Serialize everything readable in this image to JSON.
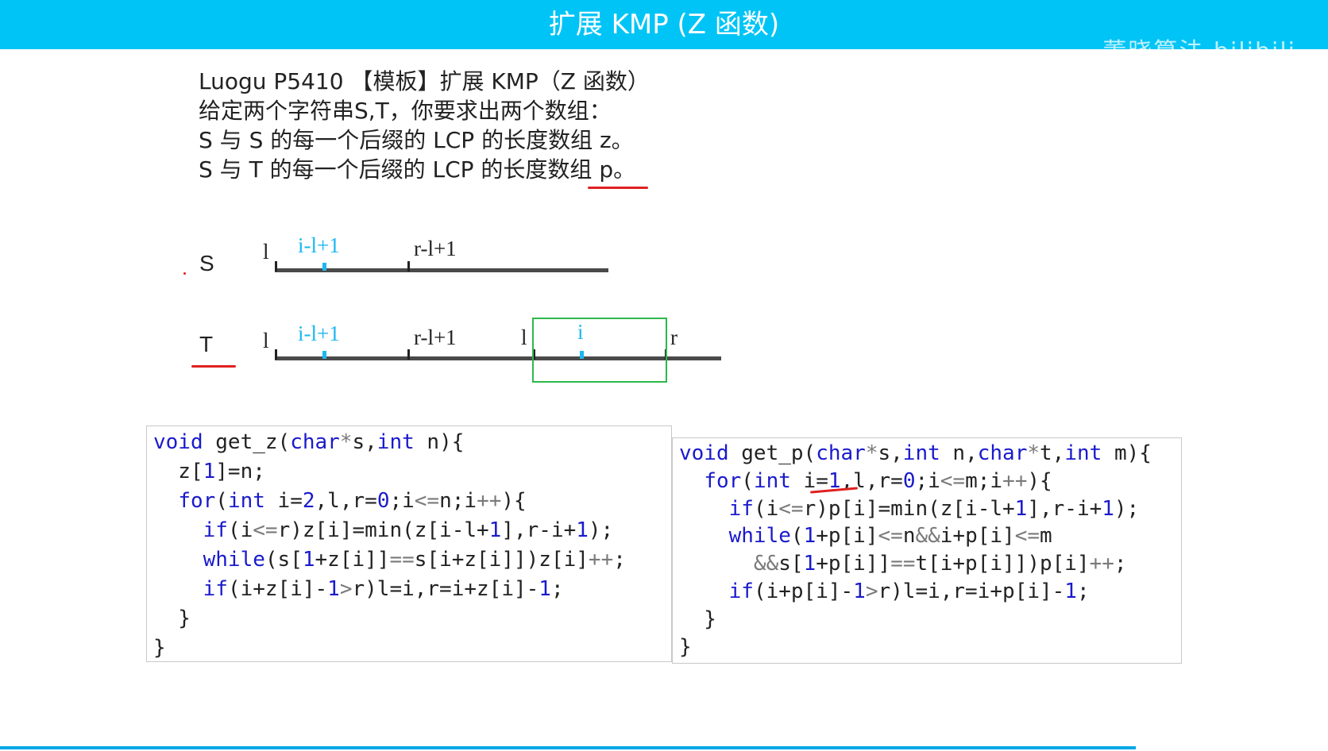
{
  "header": {
    "title": "扩展 KMP (Z 函数)",
    "watermark": "董晓算法 bilibili"
  },
  "problem": {
    "lines": [
      "Luogu P5410 【模板】扩展 KMP（Z 函数）",
      "给定两个字符串S,T，你要求出两个数组：",
      "S 与 S 的每一个后缀的 LCP 的长度数组 z。",
      "S 与 T 的每一个后缀的 LCP 的长度数组 p。"
    ]
  },
  "diagram": {
    "s_label": "S",
    "t_label": "T",
    "s_marks": {
      "l": "l",
      "il1": "i-l+1",
      "rl1": "r-l+1"
    },
    "t_marks": {
      "l1": "l",
      "il1": "i-l+1",
      "rl1": "r-l+1",
      "l2": "l",
      "i": "i",
      "r": "r"
    },
    "colors": {
      "cyan": "#1ab8f0",
      "box": "#2db84b",
      "annotation": "#e02020"
    }
  },
  "code": {
    "get_z": [
      "void get_z(char*s,int n){",
      "  z[1]=n;",
      "  for(int i=2,l,r=0;i<=n;i++){",
      "    if(i<=r)z[i]=min(z[i-l+1],r-i+1);",
      "    while(s[1+z[i]]==s[i+z[i]])z[i]++;",
      "    if(i+z[i]-1>r)l=i,r=i+z[i]-1;",
      "  }",
      "}"
    ],
    "get_p": [
      "void get_p(char*s,int n,char*t,int m){",
      "  for(int i=1,l,r=0;i<=m;i++){",
      "    if(i<=r)p[i]=min(z[i-l+1],r-i+1);",
      "    while(1+p[i]<=n&&i+p[i]<=m",
      "      &&s[1+p[i]]==t[i+p[i]])p[i]++;",
      "    if(i+p[i]-1>r)l=i,r=i+p[i]-1;",
      "  }",
      "}"
    ]
  }
}
